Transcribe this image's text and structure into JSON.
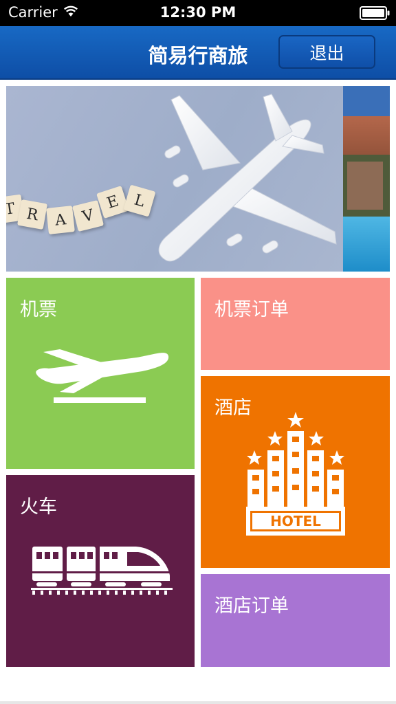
{
  "status_bar": {
    "carrier": "Carrier",
    "time": "12:30 PM",
    "wifi_icon": "wifi-icon",
    "battery_icon": "battery-icon"
  },
  "nav": {
    "title": "简易行商旅",
    "logout_label": "退出"
  },
  "banner": {
    "slides": [
      {
        "letters": [
          "T",
          "R",
          "A",
          "V",
          "E",
          "L"
        ],
        "icon": "airplane-image"
      },
      {
        "icon": "resort-pool-image"
      }
    ]
  },
  "tiles": {
    "flight": {
      "label": "机票",
      "icon": "airplane-takeoff-icon",
      "color": "#8bcb53"
    },
    "flight_order": {
      "label": "机票订单",
      "color": "#fa9188"
    },
    "hotel": {
      "label": "酒店",
      "icon": "hotel-building-icon",
      "sign_text": "HOTEL",
      "color": "#ef7300"
    },
    "train": {
      "label": "火车",
      "icon": "high-speed-train-icon",
      "color": "#601d47"
    },
    "hotel_order": {
      "label": "酒店订单",
      "color": "#a874d3"
    }
  },
  "colors": {
    "nav_blue": "#1869c4",
    "status_bar": "#000000"
  }
}
